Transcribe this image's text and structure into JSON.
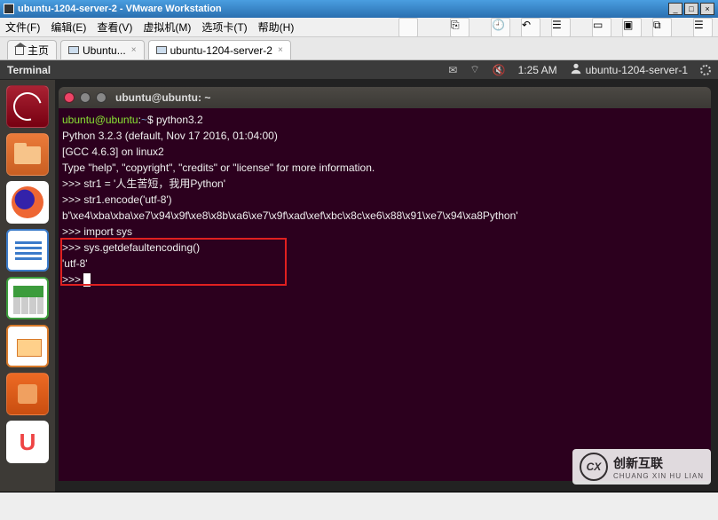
{
  "outer_window": {
    "title": "ubuntu-1204-server-2 - VMware Workstation",
    "minimize": "_",
    "maximize": "□",
    "close": "×"
  },
  "vm_menu": {
    "file": "文件(F)",
    "edit": "编辑(E)",
    "view": "查看(V)",
    "vm": "虚拟机(M)",
    "tabs": "选项卡(T)",
    "help": "帮助(H)"
  },
  "vm_tabs": {
    "home": "主页",
    "guest1": "Ubuntu...",
    "guest2": "ubuntu-1204-server-2",
    "close": "×"
  },
  "ubuntu_panel": {
    "app": "Terminal",
    "time": "1:25 AM",
    "user": "ubuntu-1204-server-1"
  },
  "terminal_title": "ubuntu@ubuntu: ~",
  "terminal": {
    "prompt_user": "ubuntu@ubuntu",
    "prompt_sep": ":",
    "prompt_path": "~",
    "prompt_end": "$ ",
    "cmd1": "python3.2",
    "line_banner1": "Python 3.2.3 (default, Nov 17 2016, 01:04:00)",
    "line_banner2": "[GCC 4.6.3] on linux2",
    "line_banner3": "Type \"help\", \"copyright\", \"credits\" or \"license\" for more information.",
    "py_prompt": ">>> ",
    "l1": "str1 = '人生苦短，我用Python'",
    "l2": "str1.encode('utf-8')",
    "out2": "b'\\xe4\\xba\\xba\\xe7\\x94\\x9f\\xe8\\x8b\\xa6\\xe7\\x9f\\xad\\xef\\xbc\\x8c\\xe6\\x88\\x91\\xe7\\x94\\xa8Python'",
    "l3": "import sys",
    "l4": "sys.getdefaultencoding()",
    "out4": "'utf-8'"
  },
  "watermark": {
    "cx": "CX",
    "line1": "创新互联",
    "line2": "CHUANG XIN HU LIAN"
  }
}
